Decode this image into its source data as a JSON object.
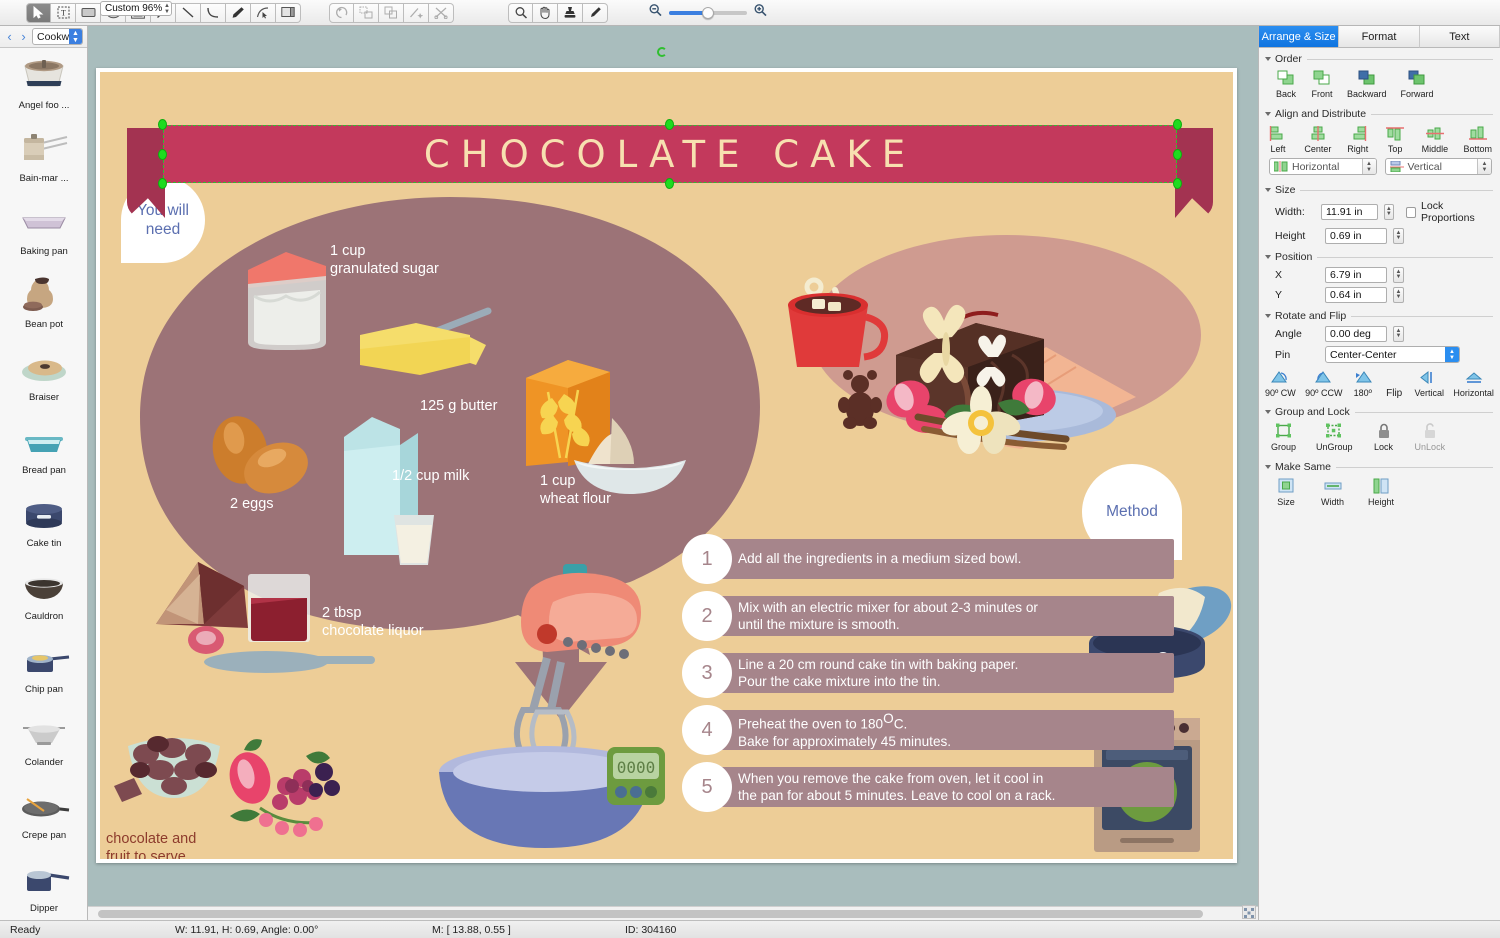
{
  "toolbar": {
    "tools": [
      {
        "name": "select-tool",
        "icon": "arrow-cursor",
        "active": true
      },
      {
        "name": "text-tool",
        "icon": "text-box"
      },
      {
        "name": "rectangle-tool",
        "icon": "rectangle"
      },
      {
        "name": "ellipse-tool",
        "icon": "ellipse"
      },
      {
        "name": "frame-tool",
        "icon": "nested-rectangle"
      },
      {
        "name": "arrow-tool",
        "icon": "arrow-line"
      },
      {
        "name": "line-tool",
        "icon": "line"
      },
      {
        "name": "curve-tool",
        "icon": "curve"
      },
      {
        "name": "pen-tool",
        "icon": "pen"
      },
      {
        "name": "edit-points-tool",
        "icon": "node-edit"
      },
      {
        "name": "callout-tool",
        "icon": "callout"
      }
    ],
    "history_tools": [
      {
        "name": "undo-rotate-tool",
        "icon": "rotate-ccw"
      },
      {
        "name": "smart-connector-tool",
        "icon": "connector"
      },
      {
        "name": "duplicate-tool",
        "icon": "duplicate"
      },
      {
        "name": "magic-line-tool",
        "icon": "magic-line"
      },
      {
        "name": "scissors-tool",
        "icon": "scissors"
      }
    ],
    "view_tools": [
      {
        "name": "zoom-tool",
        "icon": "magnifier"
      },
      {
        "name": "hand-tool",
        "icon": "hand"
      },
      {
        "name": "stamp-tool",
        "icon": "stamp"
      },
      {
        "name": "eyedropper-tool",
        "icon": "eyedropper"
      }
    ],
    "zoom_out_label": "zoom-out-icon",
    "zoom_in_label": "zoom-in-icon"
  },
  "sidebar": {
    "library_name": "Cookw...",
    "prev_label": "‹",
    "next_label": "›",
    "items": [
      {
        "label": "Angel foo ...",
        "icon": "angel-food-pan"
      },
      {
        "label": "Bain-mar ...",
        "icon": "bain-marie"
      },
      {
        "label": "Baking pan",
        "icon": "baking-pan"
      },
      {
        "label": "Bean pot",
        "icon": "bean-pot"
      },
      {
        "label": "Braiser",
        "icon": "braiser"
      },
      {
        "label": "Bread pan",
        "icon": "bread-pan"
      },
      {
        "label": "Cake tin",
        "icon": "cake-tin"
      },
      {
        "label": "Cauldron",
        "icon": "cauldron"
      },
      {
        "label": "Chip pan",
        "icon": "chip-pan"
      },
      {
        "label": "Colander",
        "icon": "colander"
      },
      {
        "label": "Crepe pan",
        "icon": "crepe-pan"
      },
      {
        "label": "Dipper",
        "icon": "dipper"
      }
    ]
  },
  "document": {
    "title": "CHOCOLATE CAKE",
    "you_will_need": "You will\nneed",
    "method_label": "Method",
    "serve_note": "chocolate and\nfruit to serve",
    "oven_temp": "180",
    "oven_temp_unit": "C",
    "timer_display": "0000",
    "ingredients": [
      {
        "name": "sugar",
        "label": "1 cup\ngranulated sugar"
      },
      {
        "name": "butter",
        "label": "125 g butter"
      },
      {
        "name": "eggs",
        "label": "2 eggs"
      },
      {
        "name": "milk",
        "label": "1/2 cup milk"
      },
      {
        "name": "flour",
        "label": "1 cup\nwheat flour"
      },
      {
        "name": "chocolate-liquor",
        "label": "2 tbsp\nchocolate liquor"
      }
    ],
    "steps": [
      {
        "number": "1",
        "text": "Add all the ingredients in a medium sized bowl."
      },
      {
        "number": "2",
        "text": "Mix with an electric mixer for about 2-3 minutes or\nuntil the mixture is smooth."
      },
      {
        "number": "3",
        "text": "Line a 20 cm round cake tin with baking paper.\nPour the cake mixture into the tin."
      },
      {
        "number": "4",
        "text": "Preheat the oven to 180°C.\nBake for approximately 45 minutes.",
        "html": true
      },
      {
        "number": "5",
        "text": "When you remove the cake from oven, let it cool in\nthe pan for about 5 minutes. Leave to cool on a rack."
      }
    ],
    "colors": {
      "artboard_bg": "#edcd97",
      "banner": "#c3395c",
      "banner_tail": "#a33351",
      "banner_text": "#f7e0b0",
      "blob": "#9c7377",
      "step_bar": "#a6858b",
      "bubble_text": "#5b6fb0",
      "serve_text": "#8d3b2c"
    }
  },
  "right_panel": {
    "tabs": [
      {
        "label": "Arrange & Size",
        "active": true
      },
      {
        "label": "Format",
        "active": false
      },
      {
        "label": "Text",
        "active": false
      }
    ],
    "order": {
      "title": "Order",
      "items": [
        {
          "label": "Back",
          "icon": "send-to-back-icon"
        },
        {
          "label": "Front",
          "icon": "bring-to-front-icon"
        },
        {
          "label": "Backward",
          "icon": "send-backward-icon"
        },
        {
          "label": "Forward",
          "icon": "bring-forward-icon"
        }
      ]
    },
    "align": {
      "title": "Align and Distribute",
      "items": [
        {
          "label": "Left",
          "icon": "align-left-icon"
        },
        {
          "label": "Center",
          "icon": "align-center-icon"
        },
        {
          "label": "Right",
          "icon": "align-right-icon"
        },
        {
          "label": "Top",
          "icon": "align-top-icon"
        },
        {
          "label": "Middle",
          "icon": "align-middle-icon"
        },
        {
          "label": "Bottom",
          "icon": "align-bottom-icon"
        }
      ],
      "distribute_horizontal": "Horizontal",
      "distribute_vertical": "Vertical"
    },
    "size": {
      "title": "Size",
      "width_label": "Width:",
      "width_value": "11.91 in",
      "height_label": "Height",
      "height_value": "0.69 in",
      "lock_proportions_label": "Lock Proportions",
      "lock_proportions_checked": false
    },
    "position": {
      "title": "Position",
      "x_label": "X",
      "x_value": "6.79 in",
      "y_label": "Y",
      "y_value": "0.64 in"
    },
    "rotate": {
      "title": "Rotate and Flip",
      "angle_label": "Angle",
      "angle_value": "0.00 deg",
      "pin_label": "Pin",
      "pin_value": "Center-Center",
      "flip_label": "Flip",
      "items": [
        {
          "label": "90º CW",
          "icon": "rotate-cw-icon"
        },
        {
          "label": "90º CCW",
          "icon": "rotate-ccw-icon"
        },
        {
          "label": "180º",
          "icon": "rotate-180-icon"
        }
      ],
      "flip_items": [
        {
          "label": "Vertical",
          "icon": "flip-vertical-icon"
        },
        {
          "label": "Horizontal",
          "icon": "flip-horizontal-icon"
        }
      ]
    },
    "group": {
      "title": "Group and Lock",
      "items": [
        {
          "label": "Group",
          "icon": "group-icon"
        },
        {
          "label": "UnGroup",
          "icon": "ungroup-icon"
        },
        {
          "label": "Lock",
          "icon": "lock-icon"
        },
        {
          "label": "UnLock",
          "icon": "unlock-icon"
        }
      ]
    },
    "make_same": {
      "title": "Make Same",
      "items": [
        {
          "label": "Size",
          "icon": "same-size-icon"
        },
        {
          "label": "Width",
          "icon": "same-width-icon"
        },
        {
          "label": "Height",
          "icon": "same-height-icon"
        }
      ]
    }
  },
  "status_bar": {
    "state": "Ready",
    "zoom": "Custom 96%",
    "dimensions": "W: 11.91,  H: 0.69,  Angle: 0.00°",
    "mouse": "M: [ 13.88, 0.55 ]",
    "id": "ID: 304160"
  }
}
